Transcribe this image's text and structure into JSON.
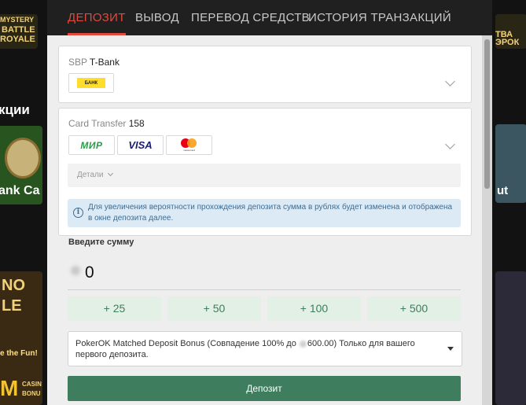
{
  "background": {
    "left_texts": [
      "MYSTERY",
      "BATTLE",
      "ROYALE",
      "кции",
      "ank Ca",
      "NO",
      "LE",
      "e the Fun!",
      "CASIN",
      "BONU"
    ],
    "right_texts": [
      "ТВА",
      "ЭРОК",
      "ut"
    ]
  },
  "tabs": [
    {
      "label": "ДЕПОЗИТ",
      "active": true
    },
    {
      "label": "ВЫВОД",
      "active": false
    },
    {
      "label": "ПЕРЕВОД СРЕДСТВ",
      "active": false
    },
    {
      "label": "ИСТОРИЯ ТРАНЗАКЦИЙ",
      "active": false
    }
  ],
  "methods": {
    "sbp": {
      "provider": "SBP",
      "bank": "T-Bank",
      "logo_text": "БАНК",
      "logo_color": "#ffdd2d"
    },
    "card": {
      "provider": "Card Transfer",
      "number": "158",
      "logos": {
        "mir": "МИР",
        "visa": "VISA",
        "mastercard_caption": "mastercard"
      }
    }
  },
  "details_label": "Детали",
  "info_text": "Для увеличения вероятности прохождения депозита сумма в рублях будет изменена и отображена в окне депозита далее.",
  "amount": {
    "label": "Введите сумму",
    "value": "0"
  },
  "quick_amounts": [
    "+ 25",
    "+ 50",
    "+ 100",
    "+ 500"
  ],
  "bonus": {
    "text_before": "PokerOK Matched Deposit Bonus (Совпадение 100% до",
    "text_after": "600.00) Только для вашего первого депозита."
  },
  "submit_label": "Депозит",
  "colors": {
    "accent_red": "#e4483c",
    "green": "#3e7d5d",
    "quick_bg": "#e3f0e6",
    "info_bg": "#dceaf5"
  }
}
